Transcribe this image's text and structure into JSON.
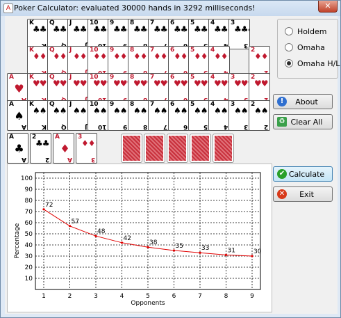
{
  "window": {
    "title": "Poker Calculator: evaluated 30000 hands in 3292 milliseconds!",
    "close_label": "✕",
    "app_icon": "A"
  },
  "deck": {
    "rows": [
      {
        "suit": "clubs",
        "symbol": "♣",
        "color": "black",
        "ranks": [
          "K",
          "Q",
          "J",
          "10",
          "9",
          "8",
          "7",
          "6",
          "5",
          "4",
          "3"
        ]
      },
      {
        "suit": "diamonds",
        "symbol": "♦",
        "color": "red",
        "ranks": [
          "K",
          "Q",
          "J",
          "10",
          "9",
          "8",
          "7",
          "6",
          "5",
          "4",
          "",
          "2"
        ]
      },
      {
        "suit": "hearts",
        "symbol": "♥",
        "color": "red",
        "ranks": [
          "A",
          "K",
          "Q",
          "J",
          "10",
          "9",
          "8",
          "7",
          "6",
          "5",
          "4",
          "3",
          "2"
        ]
      },
      {
        "suit": "spades",
        "symbol": "♠",
        "color": "black",
        "ranks": [
          "A",
          "K",
          "Q",
          "J",
          "10",
          "9",
          "8",
          "7",
          "6",
          "5",
          "4",
          "3",
          "2"
        ]
      }
    ]
  },
  "hand": [
    {
      "rank": "A",
      "symbol": "♣",
      "color": "black"
    },
    {
      "rank": "2",
      "symbol": "♣",
      "color": "black"
    },
    {
      "rank": "A",
      "symbol": "♦",
      "color": "red"
    },
    {
      "rank": "3",
      "symbol": "♦",
      "color": "red"
    }
  ],
  "board_backs": 5,
  "game_mode": {
    "options": [
      "Holdem",
      "Omaha",
      "Omaha H/L"
    ],
    "selected": "Omaha H/L"
  },
  "buttons": {
    "about": "About",
    "clear_all": "Clear All",
    "calculate": "Calculate",
    "exit": "Exit"
  },
  "colors": {
    "series": "#e00000",
    "about_icon": "#2f6fd0",
    "clear_icon": "#3aa04a",
    "calculate_icon": "#2aa02a",
    "exit_icon": "#d83a1a"
  },
  "chart_data": {
    "type": "line",
    "xlabel": "Opponents",
    "ylabel": "Percentage",
    "x": [
      1,
      2,
      3,
      4,
      5,
      6,
      7,
      8,
      9
    ],
    "values": [
      72,
      57,
      48,
      42,
      38,
      35,
      33,
      31,
      30
    ],
    "ylim": [
      0,
      100
    ],
    "yticks": [
      10,
      20,
      30,
      40,
      50,
      60,
      70,
      80,
      90,
      100
    ],
    "grid": true,
    "legend": "none"
  }
}
